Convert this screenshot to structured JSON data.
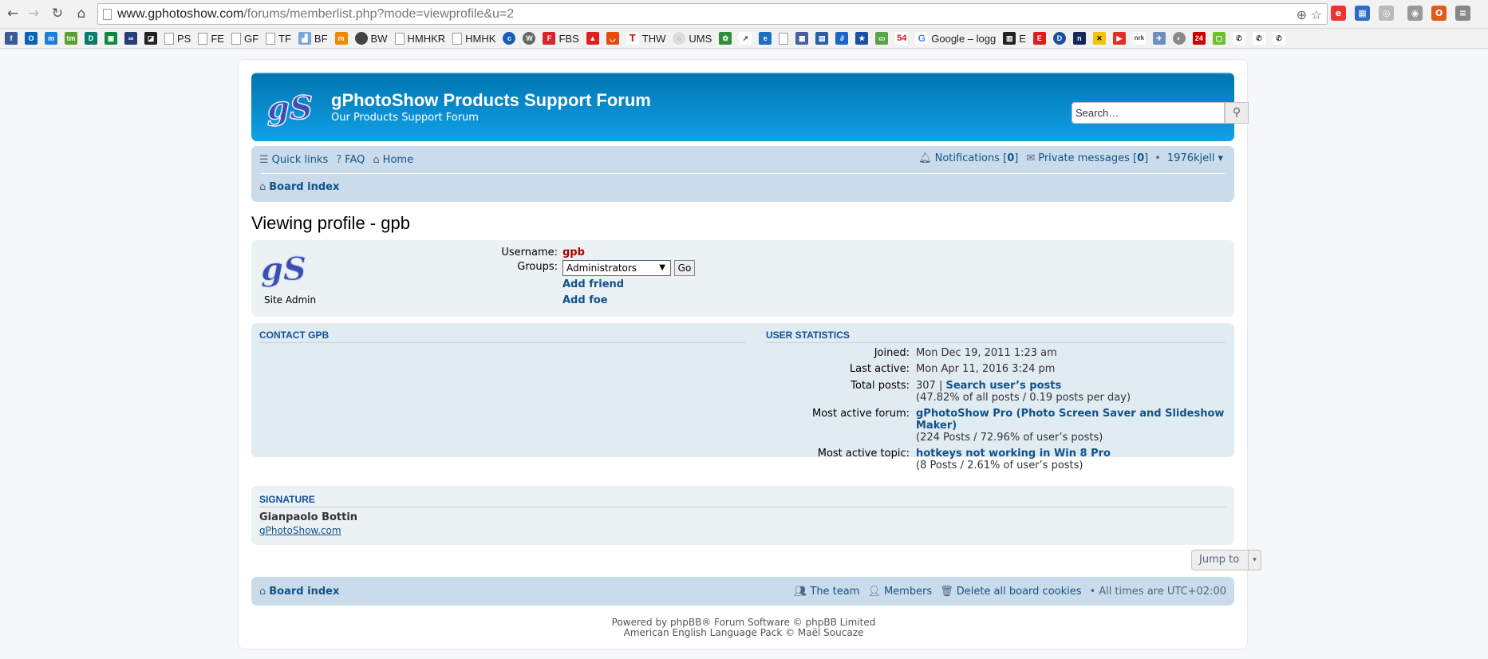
{
  "browser": {
    "url_main": "www.gphotoshow.com",
    "url_rest": "/forums/memberlist.php?mode=viewprofile&u=2",
    "bookmarks": [
      "PS",
      "FE",
      "GF",
      "TF",
      "BF",
      "BW",
      "HMHKR",
      "HMHK",
      "FBS",
      "THW",
      "UMS",
      "Google – logg",
      "E",
      "54"
    ]
  },
  "header": {
    "title": "gPhotoShow Products Support Forum",
    "description": "Our Products Support Forum",
    "logo_text": "gS",
    "search_placeholder": "Search…"
  },
  "navbar": {
    "quick_links": "Quick links",
    "faq": "FAQ",
    "home": "Home",
    "notifications": "Notifications",
    "notifications_count": "0",
    "private_messages": "Private messages",
    "pm_count": "0",
    "user": "1976kjell ▾",
    "board_index": "Board index"
  },
  "profile": {
    "page_title": "Viewing profile - gpb",
    "avatar_text": "gS",
    "rank": "Site Admin",
    "username_label": "Username:",
    "username": "gpb",
    "groups_label": "Groups:",
    "groups_selected": "Administrators",
    "go_button": "Go",
    "add_friend": "Add friend",
    "add_foe": "Add foe"
  },
  "contact": {
    "title": "CONTACT GPB"
  },
  "stats": {
    "title": "USER STATISTICS",
    "joined_label": "Joined:",
    "joined": "Mon Dec 19, 2011 1:23 am",
    "last_active_label": "Last active:",
    "last_active": "Mon Apr 11, 2016 3:24 pm",
    "total_posts_label": "Total posts:",
    "total_posts": "307 |",
    "search_posts": "Search user’s posts",
    "posts_detail": "(47.82% of all posts / 0.19 posts per day)",
    "active_forum_label": "Most active forum:",
    "active_forum_line1": "gPhotoShow Pro (Photo Screen Saver and Slideshow",
    "active_forum_line2": "Maker)",
    "active_forum_detail": "(224 Posts / 72.96% of user’s posts)",
    "active_topic_label": "Most active topic:",
    "active_topic": "hotkeys not working in Win 8 Pro",
    "active_topic_detail": "(8 Posts / 2.61% of user’s posts)"
  },
  "signature": {
    "title": "SIGNATURE",
    "name": "Gianpaolo Bottin",
    "link": "gPhotoShow.com"
  },
  "jump_to": "Jump to",
  "footer": {
    "board_index": "Board index",
    "team": "The team",
    "members": "Members",
    "delete_cookies": "Delete all board cookies",
    "timezone": "All times are UTC+02:00",
    "powered_by": "Powered by phpBB® Forum Software © phpBB Limited",
    "language_pack": "American English Language Pack © Maël Soucaze"
  }
}
